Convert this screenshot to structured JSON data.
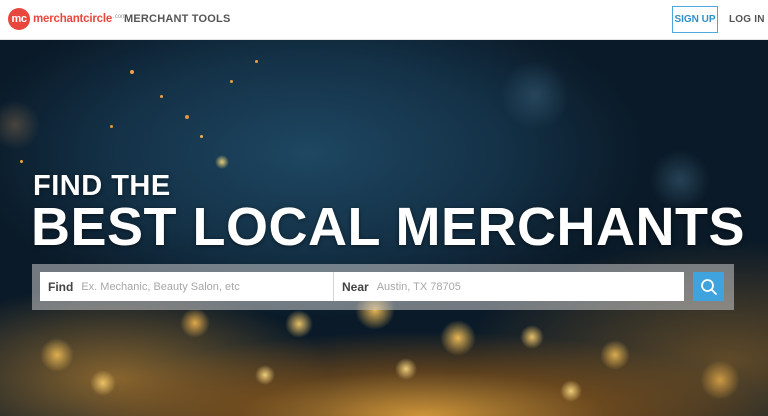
{
  "header": {
    "logo_badge": "mc",
    "logo_text": "merchantcircle",
    "logo_suffix": ".com",
    "nav_merchant_tools": "MERCHANT TOOLS",
    "signup_label": "SIGN UP",
    "login_label": "LOG IN"
  },
  "hero": {
    "line1": "FIND THE",
    "line2": "BEST LOCAL MERCHANTS"
  },
  "search": {
    "find_label": "Find",
    "find_placeholder": "Ex. Mechanic, Beauty Salon, etc",
    "find_value": "",
    "near_label": "Near",
    "near_placeholder": "Austin, TX 78705",
    "near_value": "",
    "button_icon": "search-icon"
  },
  "colors": {
    "brand": "#e8473d",
    "accent": "#3fa3dd",
    "signup_border": "#4aa8dc"
  }
}
